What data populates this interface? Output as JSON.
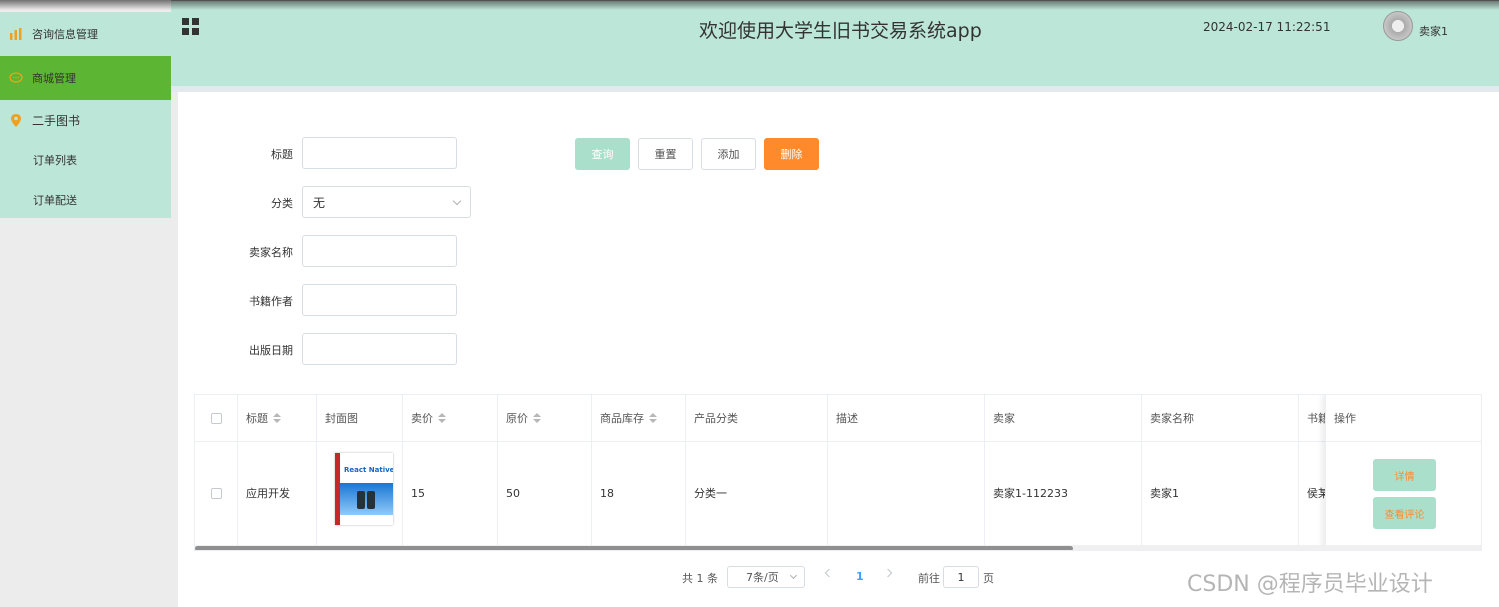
{
  "header": {
    "app_title": "欢迎使用大学生旧书交易系统app",
    "datetime": "2024-02-17 11:22:51",
    "username": "卖家1"
  },
  "sidebar": {
    "items": [
      {
        "label": "咨询信息管理",
        "icon": "bar-chart-icon"
      },
      {
        "label": "商城管理",
        "icon": "chat-icon"
      },
      {
        "label": "二手图书",
        "icon": "location-pin-icon"
      }
    ],
    "sub_items": [
      "订单列表",
      "订单配送"
    ]
  },
  "form": {
    "title_label": "标题",
    "title_value": "",
    "category_label": "分类",
    "category_value": "无",
    "seller_name_label": "卖家名称",
    "seller_name_value": "",
    "author_label": "书籍作者",
    "author_value": "",
    "publish_date_label": "出版日期",
    "publish_date_value": ""
  },
  "buttons": {
    "query": "查询",
    "reset": "重置",
    "add": "添加",
    "delete": "删除"
  },
  "table": {
    "headers": [
      "标题",
      "封面图",
      "卖价",
      "原价",
      "商品库存",
      "产品分类",
      "描述",
      "卖家",
      "卖家名称",
      "书籍",
      "操作"
    ],
    "rows": [
      {
        "title": "应用开发",
        "cover_text": "React Native",
        "price": "15",
        "original_price": "50",
        "stock": "18",
        "category": "分类一",
        "description": "",
        "seller": "卖家1-112233",
        "seller_name": "卖家1",
        "author": "侯某",
        "actions": [
          "详情",
          "查看评论"
        ]
      }
    ]
  },
  "pagination": {
    "total": "共 1 条",
    "page_size": "7条/页",
    "current_page": "1",
    "goto_prefix": "前往",
    "goto_value": "1",
    "goto_suffix": "页"
  },
  "watermark": "CSDN @程序员毕业设计",
  "colors": {
    "header_bg": "#bce6d7",
    "active_menu": "#5cb533",
    "query_btn": "#a9dfcb",
    "delete_btn": "#ff8a2b"
  }
}
